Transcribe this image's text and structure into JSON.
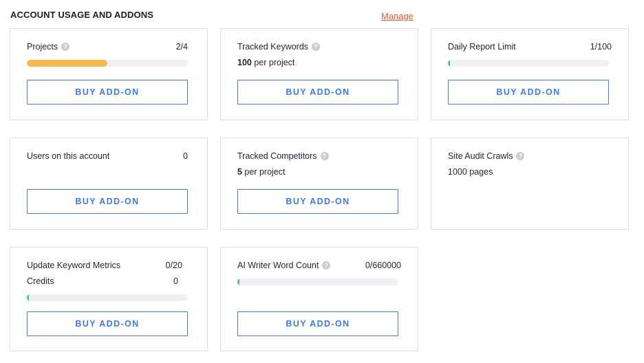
{
  "header": {
    "title": "ACCOUNT USAGE AND ADDONS",
    "manage_label": "Manage"
  },
  "colors": {
    "accent": "#3d7ae6",
    "manage": "#e3572d",
    "progress_orange": "#f5b94b",
    "progress_green": "#34c79b"
  },
  "cards": {
    "projects": {
      "label": "Projects",
      "value": "2/4",
      "progress": 0.5,
      "button": "BUY ADD-ON",
      "help_icon": "question-icon"
    },
    "tracked_keywords": {
      "label": "Tracked Keywords",
      "sub_bold": "100",
      "sub_text": " per project",
      "button": "BUY ADD-ON",
      "help_icon": "question-icon"
    },
    "daily_report_limit": {
      "label": "Daily Report Limit",
      "value": "1/100",
      "progress": 0.01,
      "button": "BUY ADD-ON"
    },
    "users": {
      "label": "Users on this account",
      "value": "0",
      "button": "BUY ADD-ON"
    },
    "tracked_competitors": {
      "label": "Tracked Competitors",
      "sub_bold": "5",
      "sub_text": " per project",
      "button": "BUY ADD-ON",
      "help_icon": "question-icon"
    },
    "site_audit_crawls": {
      "label": "Site Audit Crawls",
      "sub_text": "1000 pages",
      "help_icon": "question-icon"
    },
    "update_keyword_metrics": {
      "label": "Update Keyword Metrics",
      "value": "0/20",
      "label2": "Credits",
      "value2": "0",
      "progress": 0.0,
      "button": "BUY ADD-ON"
    },
    "ai_writer": {
      "label": "AI Writer Word Count",
      "value": "0/660000",
      "progress": 0.0,
      "button": "BUY ADD-ON",
      "help_icon": "question-icon"
    }
  }
}
